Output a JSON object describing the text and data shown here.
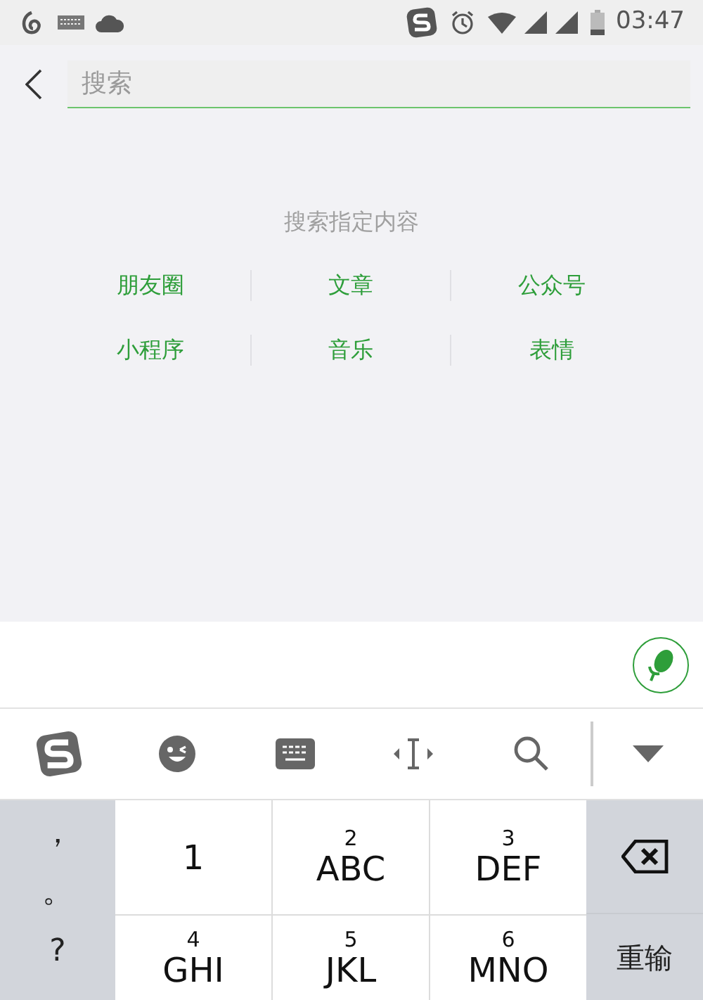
{
  "status_bar": {
    "time": "03:47"
  },
  "search": {
    "placeholder": "搜索"
  },
  "hint": "搜索指定内容",
  "categories": [
    "朋友圈",
    "文章",
    "公众号",
    "小程序",
    "音乐",
    "表情"
  ],
  "keyboard": {
    "symbols": [
      "，",
      "。",
      "?"
    ],
    "keys": [
      {
        "letters": "1"
      },
      {
        "number": "2",
        "letters": "ABC"
      },
      {
        "number": "3",
        "letters": "DEF"
      },
      {
        "number": "4",
        "letters": "GHI"
      },
      {
        "number": "5",
        "letters": "JKL"
      },
      {
        "number": "6",
        "letters": "MNO"
      }
    ],
    "reset_key": "重输"
  }
}
